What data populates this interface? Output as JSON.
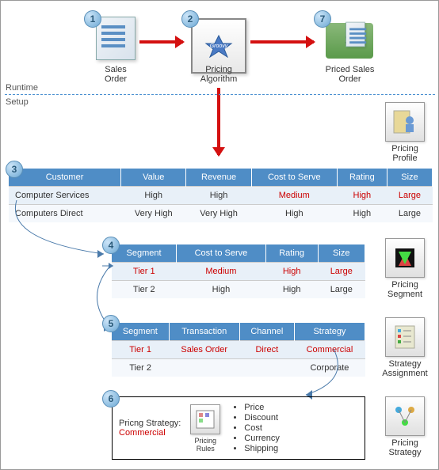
{
  "sections": {
    "runtime": "Runtime",
    "setup": "Setup"
  },
  "nodes": {
    "sales_order": "Sales\nOrder",
    "algo": "Pricing\nAlgorithm",
    "algo_logo": "Groovy",
    "priced": "Priced Sales\nOrder"
  },
  "badges": {
    "1": "1",
    "2": "2",
    "3": "3",
    "4": "4",
    "5": "5",
    "6": "6",
    "7": "7"
  },
  "side": {
    "profile": "Pricing\nProfile",
    "segment": "Pricing\nSegment",
    "strategy_assign": "Strategy\nAssignment",
    "strategy": "Pricing\nStrategy"
  },
  "t3": {
    "headers": [
      "Customer",
      "Value",
      "Revenue",
      "Cost to Serve",
      "Rating",
      "Size"
    ],
    "rows": [
      {
        "cells": [
          "Computer Services",
          "High",
          "High",
          "Medium",
          "High",
          "Large"
        ],
        "highlight": [
          false,
          false,
          false,
          true,
          true,
          true
        ]
      },
      {
        "cells": [
          "Computers Direct",
          "Very High",
          "Very High",
          "High",
          "High",
          "Large"
        ],
        "highlight": [
          false,
          false,
          false,
          false,
          false,
          false
        ]
      }
    ]
  },
  "t4": {
    "headers": [
      "Segment",
      "Cost to Serve",
      "Rating",
      "Size"
    ],
    "rows": [
      {
        "cells": [
          "Tier 1",
          "Medium",
          "High",
          "Large"
        ],
        "highlight": [
          true,
          true,
          true,
          true
        ]
      },
      {
        "cells": [
          "Tier 2",
          "High",
          "High",
          "Large"
        ],
        "highlight": [
          false,
          false,
          false,
          false
        ]
      }
    ]
  },
  "t5": {
    "headers": [
      "Segment",
      "Transaction",
      "Channel",
      "Strategy"
    ],
    "rows": [
      {
        "cells": [
          "Tier 1",
          "Sales Order",
          "Direct",
          "Commercial"
        ],
        "highlight": [
          true,
          true,
          true,
          true
        ]
      },
      {
        "cells": [
          "Tier 2",
          "",
          "",
          "Corporate"
        ],
        "highlight": [
          false,
          false,
          false,
          false
        ]
      }
    ]
  },
  "strategy_box": {
    "label": "Pricng Strategy:",
    "value": "Commercial",
    "rules_label": "Pricing\nRules",
    "bullets": [
      "Price",
      "Discount",
      "Cost",
      "Currency",
      "Shipping"
    ]
  }
}
